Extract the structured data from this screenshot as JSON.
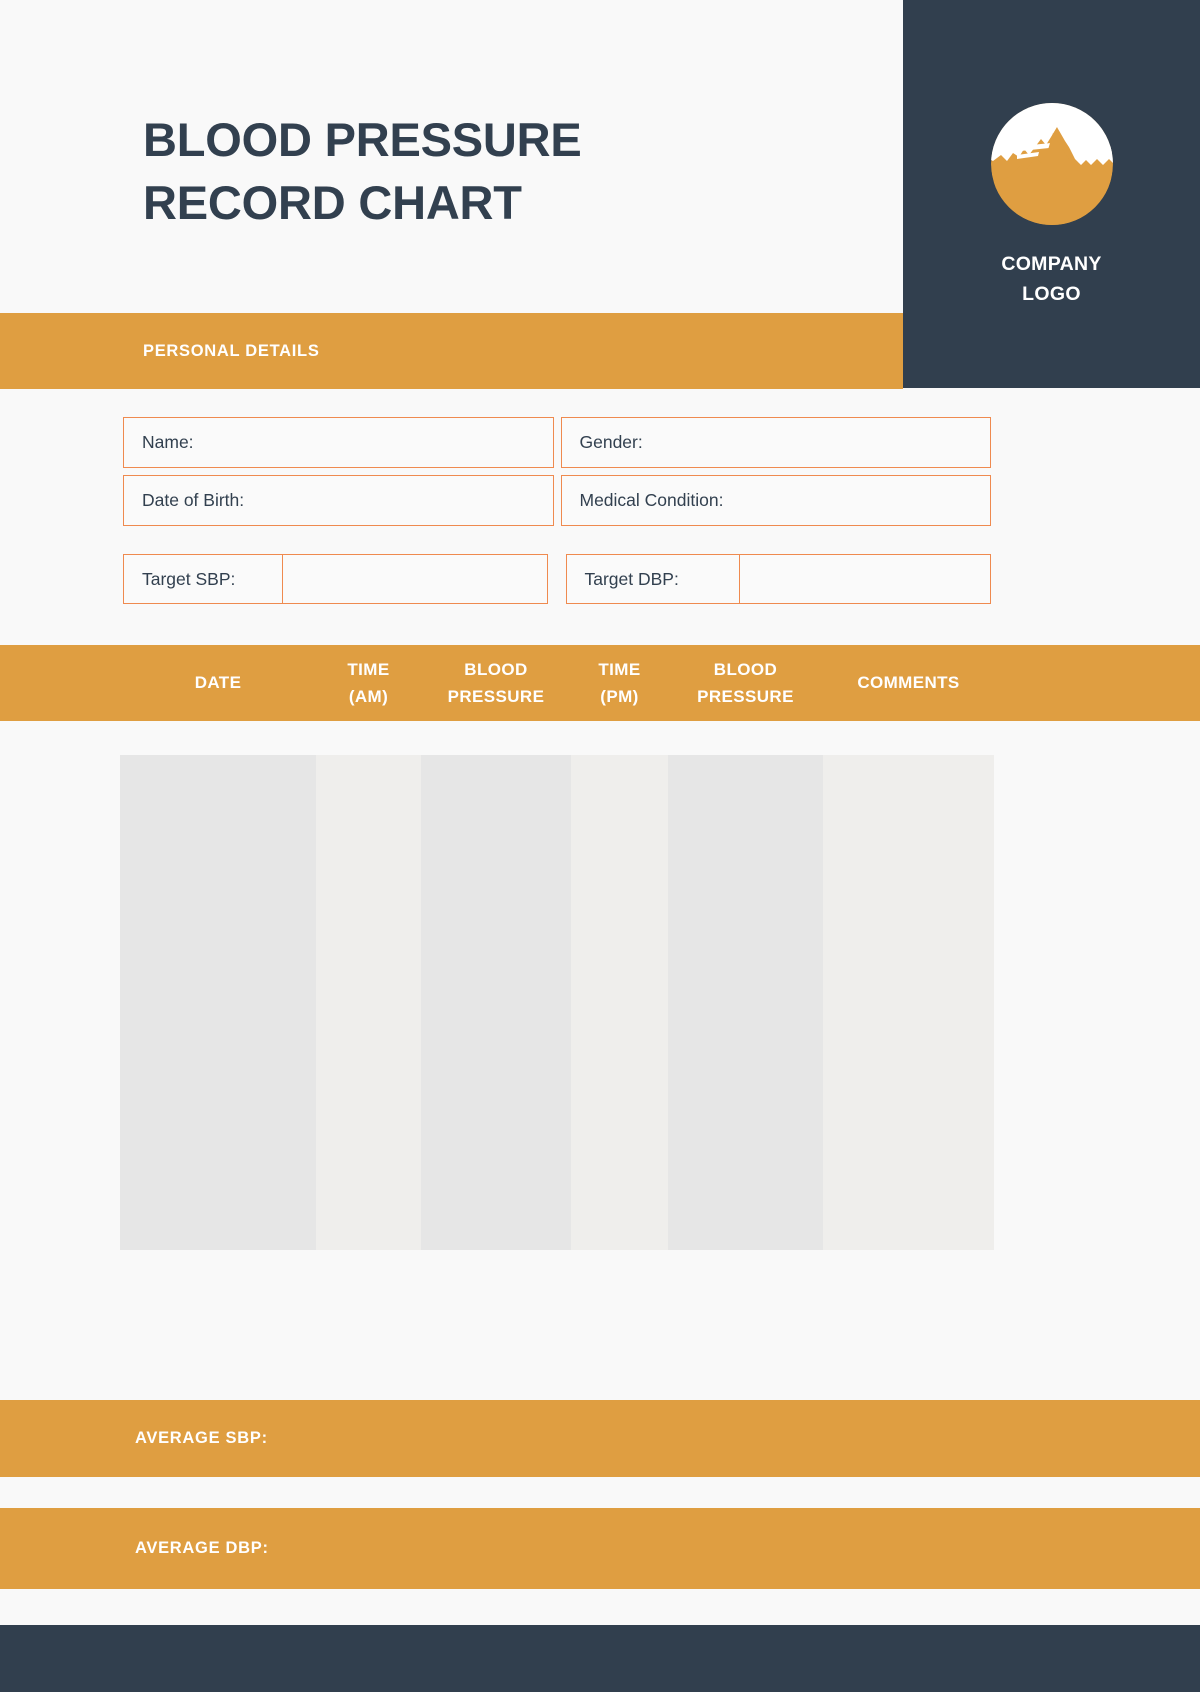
{
  "document": {
    "title_line_1": "BLOOD PRESSURE",
    "title_line_2": "RECORD CHART"
  },
  "logo": {
    "icon_name": "mountain-circle-logo-icon",
    "caption_line_1": "COMPANY",
    "caption_line_2": "LOGO"
  },
  "sections": {
    "personal_details_label": "PERSONAL DETAILS",
    "average_sbp_label": "AVERAGE SBP:",
    "average_dbp_label": "AVERAGE DBP:"
  },
  "personal_details": {
    "fields": [
      {
        "label": "Name:",
        "value": "",
        "placeholder": ""
      },
      {
        "label": "Gender:",
        "value": "",
        "placeholder": ""
      },
      {
        "label": "Date of Birth:",
        "value": "",
        "placeholder": ""
      },
      {
        "label": "Medical Condition:",
        "value": "",
        "placeholder": ""
      },
      {
        "label": "Target SBP:",
        "value": "",
        "placeholder": ""
      },
      {
        "label": "Target DBP:",
        "value": "",
        "placeholder": ""
      }
    ]
  },
  "record_table": {
    "columns": [
      {
        "header_line_1": "DATE",
        "header_line_2": ""
      },
      {
        "header_line_1": "TIME",
        "header_line_2": "(AM)"
      },
      {
        "header_line_1": "BLOOD",
        "header_line_2": "PRESSURE"
      },
      {
        "header_line_1": "TIME",
        "header_line_2": "(PM)"
      },
      {
        "header_line_1": "BLOOD",
        "header_line_2": "PRESSURE"
      },
      {
        "header_line_1": "COMMENTS",
        "header_line_2": ""
      }
    ],
    "rows": []
  },
  "colors": {
    "accent_orange": "#df9e41",
    "field_border_orange": "#ef8a4f",
    "dark_navy": "#313f4e",
    "page_background": "#f9f9f9",
    "column_shade_dark": "#e6e6e6",
    "column_shade_light": "#efeeec"
  }
}
